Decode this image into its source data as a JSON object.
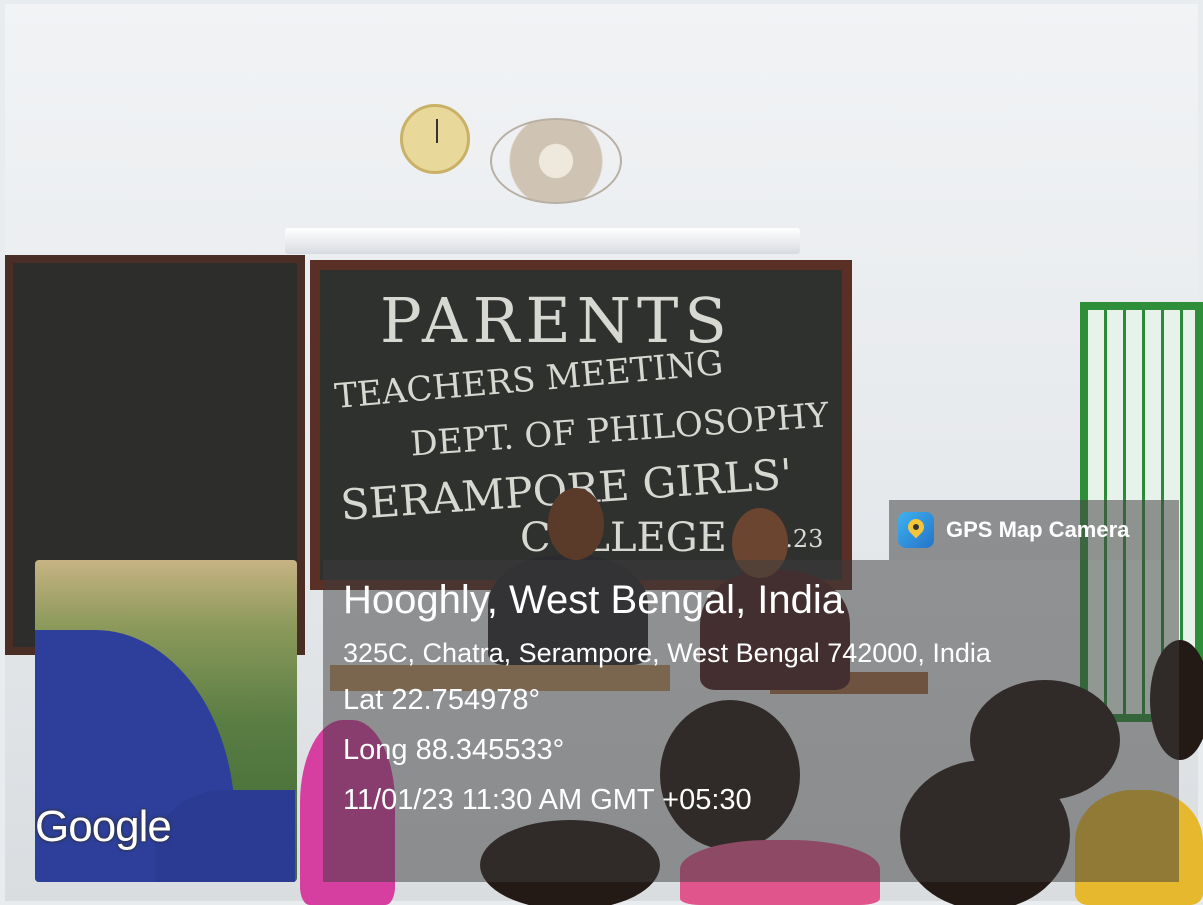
{
  "board": {
    "line1": "PARENTS",
    "line2": "TEACHERS MEETING",
    "line3": "DEPT. OF PHILOSOPHY",
    "line4": "SERAMPORE GIRLS'",
    "line5": "COLLEGE",
    "date_fragment": "1.23"
  },
  "watermark": {
    "app_name": "GPS Map Camera",
    "app_icon": "map-pin-camera-icon"
  },
  "location": {
    "title": "Hooghly, West Bengal, India",
    "address": "325C, Chatra, Serampore, West Bengal 742000, India",
    "lat": "Lat 22.754978°",
    "long": "Long 88.345533°",
    "timestamp": "11/01/23 11:30 AM GMT +05:30"
  },
  "map": {
    "provider": "Google"
  }
}
